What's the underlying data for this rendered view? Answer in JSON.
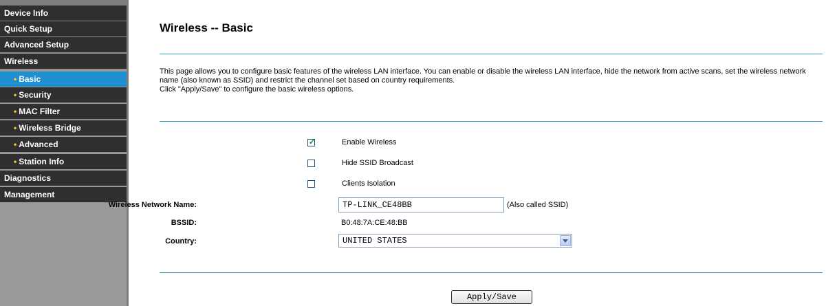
{
  "sidebar": {
    "items": [
      {
        "label": "Device Info"
      },
      {
        "label": "Quick Setup"
      },
      {
        "label": "Advanced Setup"
      },
      {
        "label": "Wireless"
      },
      {
        "label": "Basic"
      },
      {
        "label": "Security"
      },
      {
        "label": "MAC Filter"
      },
      {
        "label": "Wireless Bridge"
      },
      {
        "label": "Advanced"
      },
      {
        "label": "Station Info"
      },
      {
        "label": "Diagnostics"
      },
      {
        "label": "Management"
      }
    ],
    "active_item": "Basic",
    "active_color": "#1f8fd0",
    "bullet": "•"
  },
  "page": {
    "title": "Wireless -- Basic",
    "description_line1": "This page allows you to configure basic features of the wireless LAN interface. You can enable or disable the wireless LAN interface, hide the network from active scans, set the wireless network name (also known as SSID) and restrict the channel set based on country requirements.",
    "description_line2": "Click \"Apply/Save\" to configure the basic wireless options."
  },
  "form": {
    "enable_wireless": {
      "label": "Enable Wireless",
      "checked": true
    },
    "hide_ssid": {
      "label": "Hide SSID Broadcast",
      "checked": false
    },
    "clients_isolation": {
      "label": "Clients Isolation",
      "checked": false
    },
    "ssid": {
      "label": "Wireless Network Name:",
      "value": "TP-LINK_CE48BB",
      "note": "(Also called SSID)"
    },
    "bssid": {
      "label": "BSSID:",
      "value": "B0:48:7A:CE:48:BB"
    },
    "country": {
      "label": "Country:",
      "value": "UNITED STATES"
    },
    "apply_label": "Apply/Save",
    "check_mark": "✓"
  }
}
